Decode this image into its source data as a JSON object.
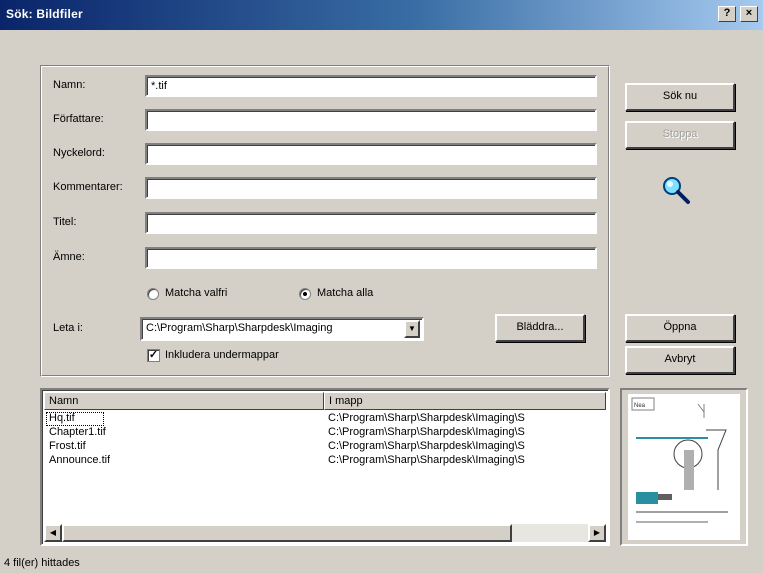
{
  "window": {
    "title": "Sök: Bildfiler",
    "help_label": "?",
    "close_label": "×"
  },
  "form": {
    "name": {
      "label": "Namn:",
      "value": "*.tif"
    },
    "author": {
      "label": "Författare:",
      "value": ""
    },
    "keywords": {
      "label": "Nyckelord:",
      "value": ""
    },
    "comments": {
      "label": "Kommentarer:",
      "value": ""
    },
    "title": {
      "label": "Titel:",
      "value": ""
    },
    "subject": {
      "label": "Ämne:",
      "value": ""
    },
    "match_any": {
      "label": "Matcha valfri",
      "checked": false
    },
    "match_all": {
      "label": "Matcha alla",
      "checked": true
    },
    "look_in": {
      "label": "Leta i:",
      "value": "C:\\Program\\Sharp\\Sharpdesk\\Imaging"
    },
    "browse_label": "Bläddra...",
    "include_subfolders": {
      "label": "Inkludera undermappar",
      "checked": true
    }
  },
  "buttons": {
    "search_now": "Sök nu",
    "stop": "Stoppa",
    "open": "Öppna",
    "cancel": "Avbryt"
  },
  "results": {
    "columns": [
      "Namn",
      "I mapp"
    ],
    "rows": [
      {
        "name": "Hq.tif",
        "folder": "C:\\Program\\Sharp\\Sharpdesk\\Imaging\\S"
      },
      {
        "name": "Chapter1.tif",
        "folder": "C:\\Program\\Sharp\\Sharpdesk\\Imaging\\S"
      },
      {
        "name": "Frost.tif",
        "folder": "C:\\Program\\Sharp\\Sharpdesk\\Imaging\\S"
      },
      {
        "name": "Announce.tif",
        "folder": "C:\\Program\\Sharp\\Sharpdesk\\Imaging\\S"
      }
    ]
  },
  "status": "4 fil(er) hittades",
  "colors": {
    "title_start": "#0a246a",
    "title_end": "#a6caf0",
    "face": "#d4d0c8"
  },
  "icons": {
    "search": "magnifier-icon",
    "preview": "document-thumbnail"
  }
}
